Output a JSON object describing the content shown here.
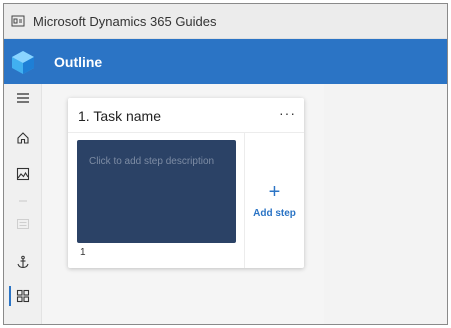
{
  "window": {
    "title": "Microsoft Dynamics 365 Guides"
  },
  "header": {
    "page_title": "Outline"
  },
  "rail": {
    "items": [
      {
        "icon": "hamburger-menu-icon",
        "enabled": true
      },
      {
        "icon": "home-icon",
        "enabled": true
      },
      {
        "icon": "image-icon",
        "enabled": true
      },
      {
        "icon": "separator",
        "enabled": false
      },
      {
        "icon": "text-block-icon",
        "enabled": false
      },
      {
        "icon": "anchor-icon",
        "enabled": true
      },
      {
        "icon": "outline-grid-icon",
        "enabled": true,
        "selected": true
      }
    ]
  },
  "task": {
    "title": "1. Task name",
    "more_label": "···",
    "steps": [
      {
        "description_placeholder": "Click to add step description",
        "number": "1"
      }
    ],
    "add_step_label": "Add step"
  },
  "colors": {
    "header_blue": "#2b74c5",
    "step_tile": "#2b4266",
    "accent": "#2b74c5"
  }
}
